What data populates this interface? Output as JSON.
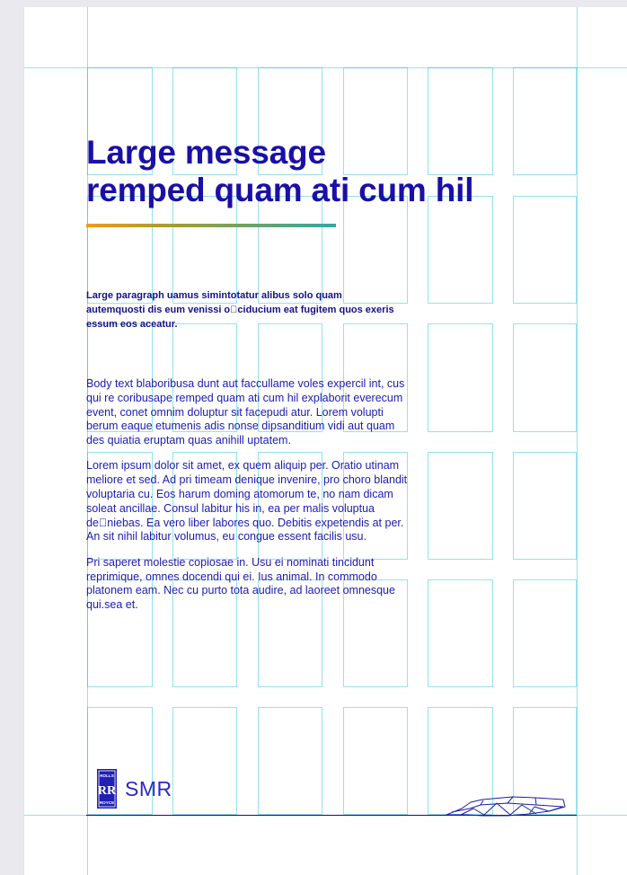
{
  "document": {
    "headline_line_1": "Large message",
    "headline_line_2": "remped quam ati cum hil",
    "lead_paragraph": "Large paragraph uamus simintotatur alibus solo quam autemquosti dis eum venissi o\u0000ciducium eat fugitem quos exeris essum eos aceatur.",
    "body_paragraphs": [
      "Body text blaboribusa dunt aut faccullame voles expercil int, cus qui re coribusape remped quam ati cum hil explaborit everecum event, conet omnim doluptur sit facepudi atur. Lorem volupti berum eaque etumenis adis nonse dipsanditium vidi aut quam des quiatia eruptam quas anihill uptatem.",
      "Lorem ipsum dolor sit amet, ex quem aliquip per. Oratio utinam meliore et sed. Ad pri timeam denique invenire, pro choro blandit voluptaria cu. Eos harum doming atomorum te, no nam dicam soleat ancillae. Consul labitur his in, ea per malis voluptua de\u0000niebas. Ea vero liber labores quo. Debitis expetendis at per. An sit nihil labitur volumus, eu congue essent facilis usu.",
      "Pri saperet molestie copiosae in. Usu ei nominati tincidunt reprimique, omnes docendi qui ei. Ius animal. In commodo platonem eam. Nec cu purto tota audire, ad laoreet omnesque qui.sea et."
    ]
  },
  "brand": {
    "badge_top": "ROLLS",
    "badge_mark": "RR",
    "badge_bottom": "ROYCE",
    "name": "SMR"
  },
  "icons": {
    "logo": "rolls-royce-badge-icon",
    "footer_graphic": "reactor-outline-icon"
  },
  "colors": {
    "headline": "#1a0fa7",
    "body": "#1a1cb0",
    "accent_start": "#f09a1f",
    "accent_end": "#33a7a2",
    "grid": "#00bad6"
  }
}
